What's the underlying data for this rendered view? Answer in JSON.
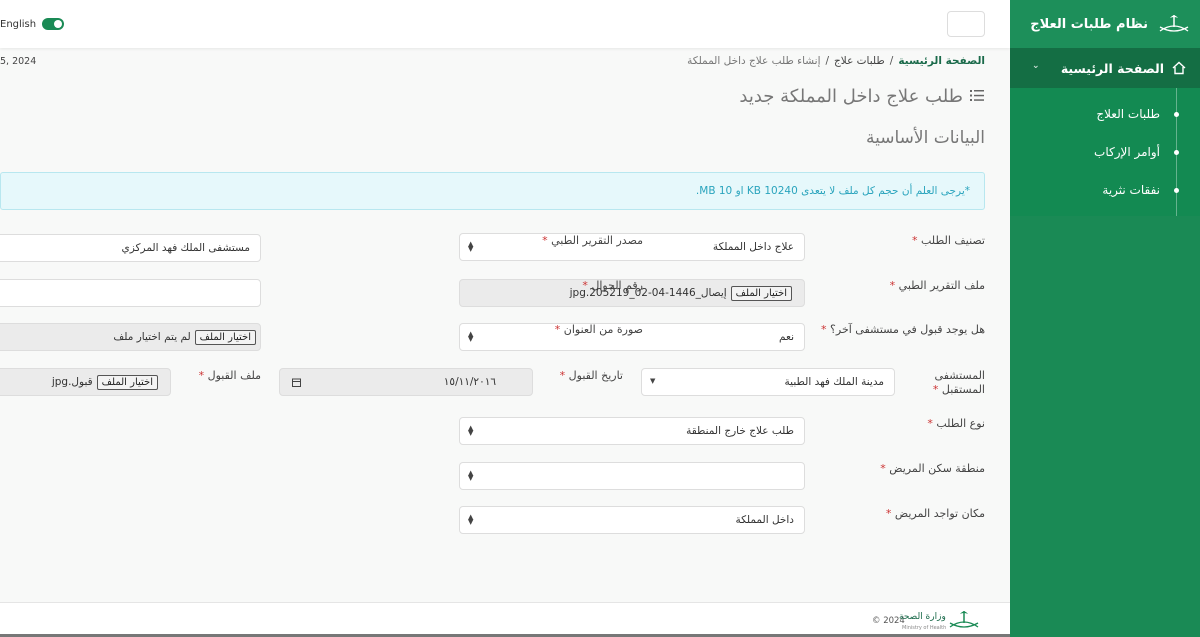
{
  "app": {
    "title": "نظام طلبات العلاج"
  },
  "sidebar": {
    "main_item": "الصفحة الرئيسية",
    "sub_items": [
      "طلبات العلاج",
      "أوامر الإركاب",
      "نفقات نثرية"
    ]
  },
  "topbar": {
    "language_label": "English",
    "date_text": "5, 2024"
  },
  "breadcrumb": {
    "home": "الصفحة الرئيسية",
    "separator": "/",
    "link": "طلبات علاج",
    "current": "إنشاء طلب علاج داخل المملكة"
  },
  "page": {
    "title": "طلب علاج داخل المملكة جديد",
    "section_title": "البيانات الأساسية",
    "alert": "*يرجى العلم أن حجم كل ملف لا يتعدى 10240 KB او MB 10."
  },
  "form": {
    "required_mark": "*",
    "file_button": "اختيار الملف",
    "request_category": {
      "label": "تصنيف الطلب",
      "value": "علاج داخل المملكة"
    },
    "report_source": {
      "label": "مصدر التقرير الطبي",
      "value": "مستشفى الملك فهد المركزي"
    },
    "medical_report_file": {
      "label": "ملف التقرير الطبي",
      "value": "إيصال_1446-04-02_205219.jpg"
    },
    "mobile_number": {
      "label": "رقم الجوال",
      "value": ""
    },
    "other_acceptance": {
      "label": "هل يوجد قبول في مستشفى آخر؟",
      "value": "نعم"
    },
    "address_image": {
      "label": "صورة من العنوان",
      "value": "لم يتم اختيار ملف"
    },
    "receiving_hospital": {
      "label_line1": "المستشفى",
      "label_line2": "المستقبل",
      "value": "مدينة الملك فهد الطبية"
    },
    "acceptance_date": {
      "label": "تاريخ القبول",
      "value": "١٥/١١/٢٠١٦"
    },
    "acceptance_file": {
      "label": "ملف القبول",
      "value": "قبول.jpg"
    },
    "request_type": {
      "label": "نوع الطلب",
      "value": "طلب علاج خارج المنطقة"
    },
    "patient_region": {
      "label": "منطقة سكن المريض",
      "value": ""
    },
    "patient_location": {
      "label": "مكان تواجد المريض",
      "value": "داخل المملكة"
    }
  },
  "footer": {
    "brand": "وزارة الصحة",
    "brand_sub": "Ministry of Health",
    "copyright": "© 2024"
  }
}
